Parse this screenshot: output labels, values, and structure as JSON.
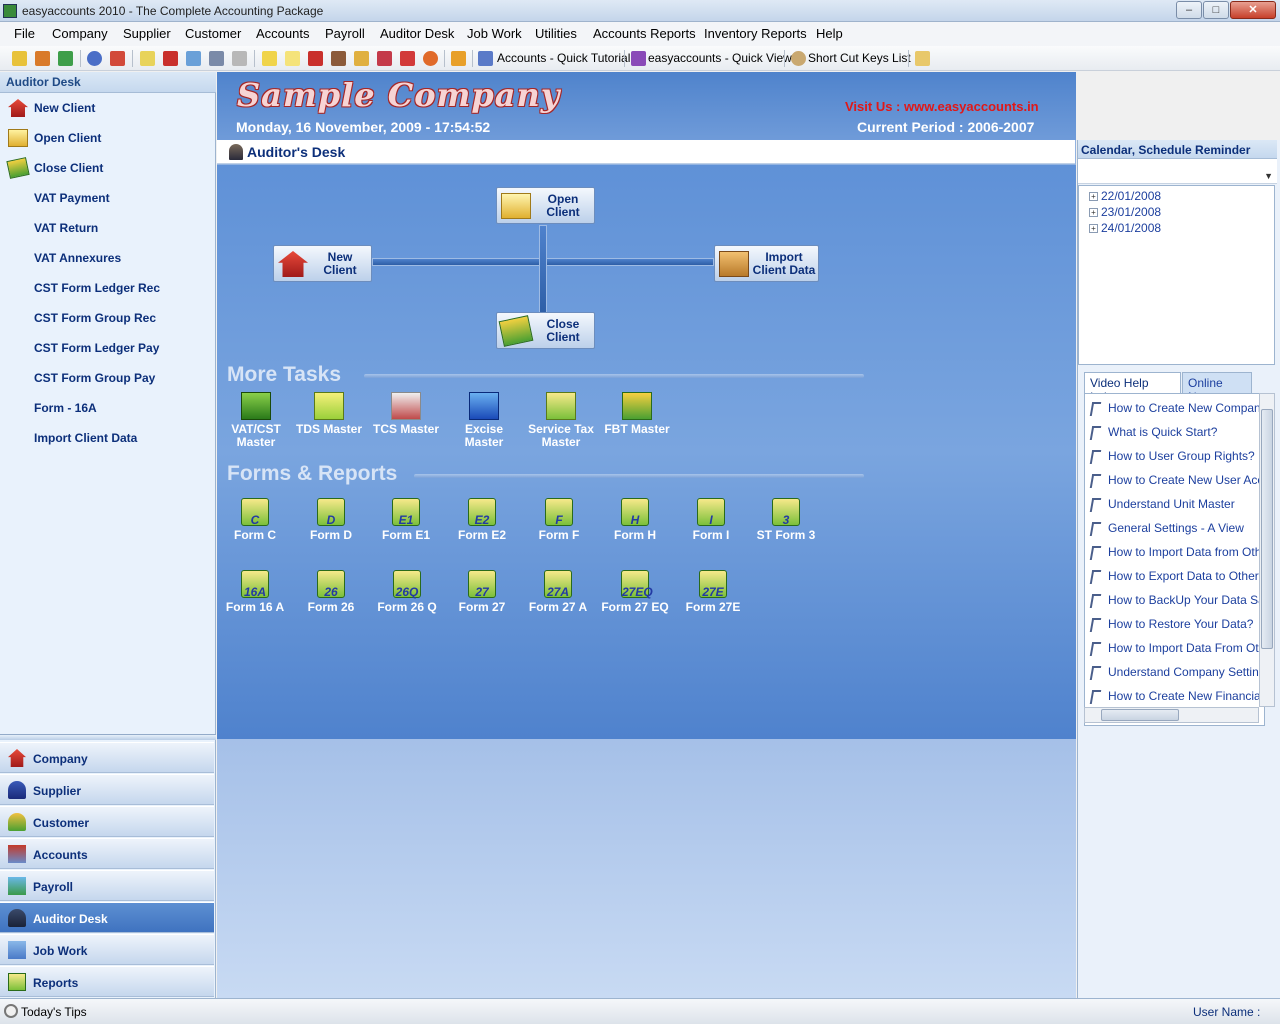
{
  "window": {
    "title": "easyaccounts 2010 - The Complete Accounting Package",
    "minimize_glyph": "–",
    "maximize_glyph": "□",
    "close_glyph": "✕"
  },
  "menu": [
    "File",
    "Company",
    "Supplier",
    "Customer",
    "Accounts",
    "Payroll",
    "Auditor Desk",
    "Job Work",
    "Utilities",
    "Accounts Reports",
    "Inventory Reports",
    "Help"
  ],
  "toolbar": {
    "quick_tutorial": "Accounts - Quick Tutorial",
    "quick_view": "easyaccounts - Quick View",
    "shortcut_keys": "Short Cut Keys List"
  },
  "left_panel": {
    "header": "Auditor Desk",
    "items": [
      "New Client",
      "Open Client",
      "Close Client",
      "VAT Payment",
      "VAT Return",
      "VAT Annexures",
      "CST Form Ledger Rec",
      "CST Form Group Rec",
      "CST Form Ledger Pay",
      "CST Form Group Pay",
      "Form - 16A",
      "Import Client Data"
    ],
    "nav": [
      "Company",
      "Supplier",
      "Customer",
      "Accounts",
      "Payroll",
      "Auditor Desk",
      "Job Work",
      "Reports"
    ],
    "active_nav": "Auditor Desk"
  },
  "banner": {
    "company": "Sample Company",
    "visit": "Visit Us : www.easyaccounts.in",
    "date": "Monday, 16 November, 2009 - 17:54:52",
    "period": "Current Period : 2006-2007"
  },
  "desk": {
    "title": "Auditor's Desk",
    "open_client": "Open Client",
    "new_client": "New Client",
    "import_client": "Import Client Data",
    "close_client": "Close Client"
  },
  "more_tasks": {
    "title": "More Tasks",
    "items": [
      "VAT/CST Master",
      "TDS Master",
      "TCS Master",
      "Excise Master",
      "Service Tax Master",
      "FBT Master"
    ]
  },
  "forms_reports": {
    "title": "Forms & Reports",
    "row1": [
      {
        "label": "Form C",
        "code": "C"
      },
      {
        "label": "Form D",
        "code": "D"
      },
      {
        "label": "Form E1",
        "code": "E1"
      },
      {
        "label": "Form E2",
        "code": "E2"
      },
      {
        "label": "Form F",
        "code": "F"
      },
      {
        "label": "Form H",
        "code": "H"
      },
      {
        "label": "Form I",
        "code": "I"
      },
      {
        "label": "ST Form 3",
        "code": "3"
      }
    ],
    "row2": [
      {
        "label": "Form 16 A",
        "code": "16A"
      },
      {
        "label": "Form 26",
        "code": "26"
      },
      {
        "label": "Form 26 Q",
        "code": "26Q"
      },
      {
        "label": "Form 27",
        "code": "27"
      },
      {
        "label": "Form 27 A",
        "code": "27A"
      },
      {
        "label": "Form 27 EQ",
        "code": "27EQ"
      },
      {
        "label": "Form 27E",
        "code": "27E"
      }
    ]
  },
  "calendar": {
    "header": "Calendar, Schedule Reminder",
    "dates": [
      "22/01/2008",
      "23/01/2008",
      "24/01/2008"
    ],
    "expand_glyph": "+",
    "dropdown_glyph": "▼"
  },
  "help": {
    "tab_video": "Video Help Index",
    "tab_news": "Online News",
    "items": [
      "How to Create New Company?",
      "What is Quick Start?",
      "How to User Group Rights?",
      "How to Create New User Account?",
      "Understand Unit Master",
      "General Settings - A View",
      "How to Import Data from Other?",
      "How to Export Data to Other?",
      "How to BackUp Your Data Safely?",
      "How to Restore Your Data?",
      "How to Import Data From Other?",
      "Understand Company Settings",
      "How to Create New Financial Year?"
    ]
  },
  "status": {
    "tips": "Today's Tips",
    "user": "User Name :"
  },
  "colors": {
    "accent": "#0c2f7a",
    "active_nav": "#4a7fc8",
    "visit_red": "#e01818"
  }
}
